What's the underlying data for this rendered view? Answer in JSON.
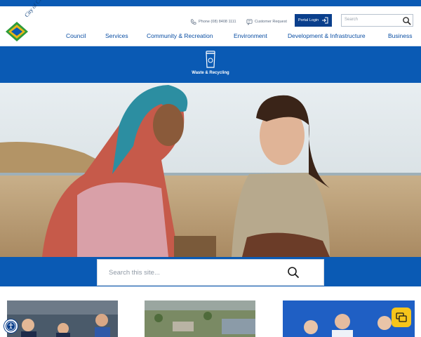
{
  "brand": {
    "name": "City of Charles Sturt",
    "primary_color": "#0a5ab4",
    "accent_color": "#f6c51b"
  },
  "header": {
    "phone_label": "Phone (08) 8408 1111",
    "customer_request_label": "Customer Request",
    "portal_login_label": "Portal Login",
    "search_placeholder": "Search"
  },
  "nav": {
    "items": [
      {
        "label": "Council"
      },
      {
        "label": "Services"
      },
      {
        "label": "Community & Recreation"
      },
      {
        "label": "Environment"
      },
      {
        "label": "Development & Infrastructure"
      },
      {
        "label": "Business"
      }
    ]
  },
  "subnav": {
    "label": "Waste & Recycling",
    "icon": "recycling-bin-icon"
  },
  "site_search": {
    "placeholder": "Search this site..."
  },
  "icons": [
    "phone-icon",
    "customer-request-icon",
    "login-icon",
    "search-icon",
    "accessibility-icon",
    "chat-icon"
  ]
}
